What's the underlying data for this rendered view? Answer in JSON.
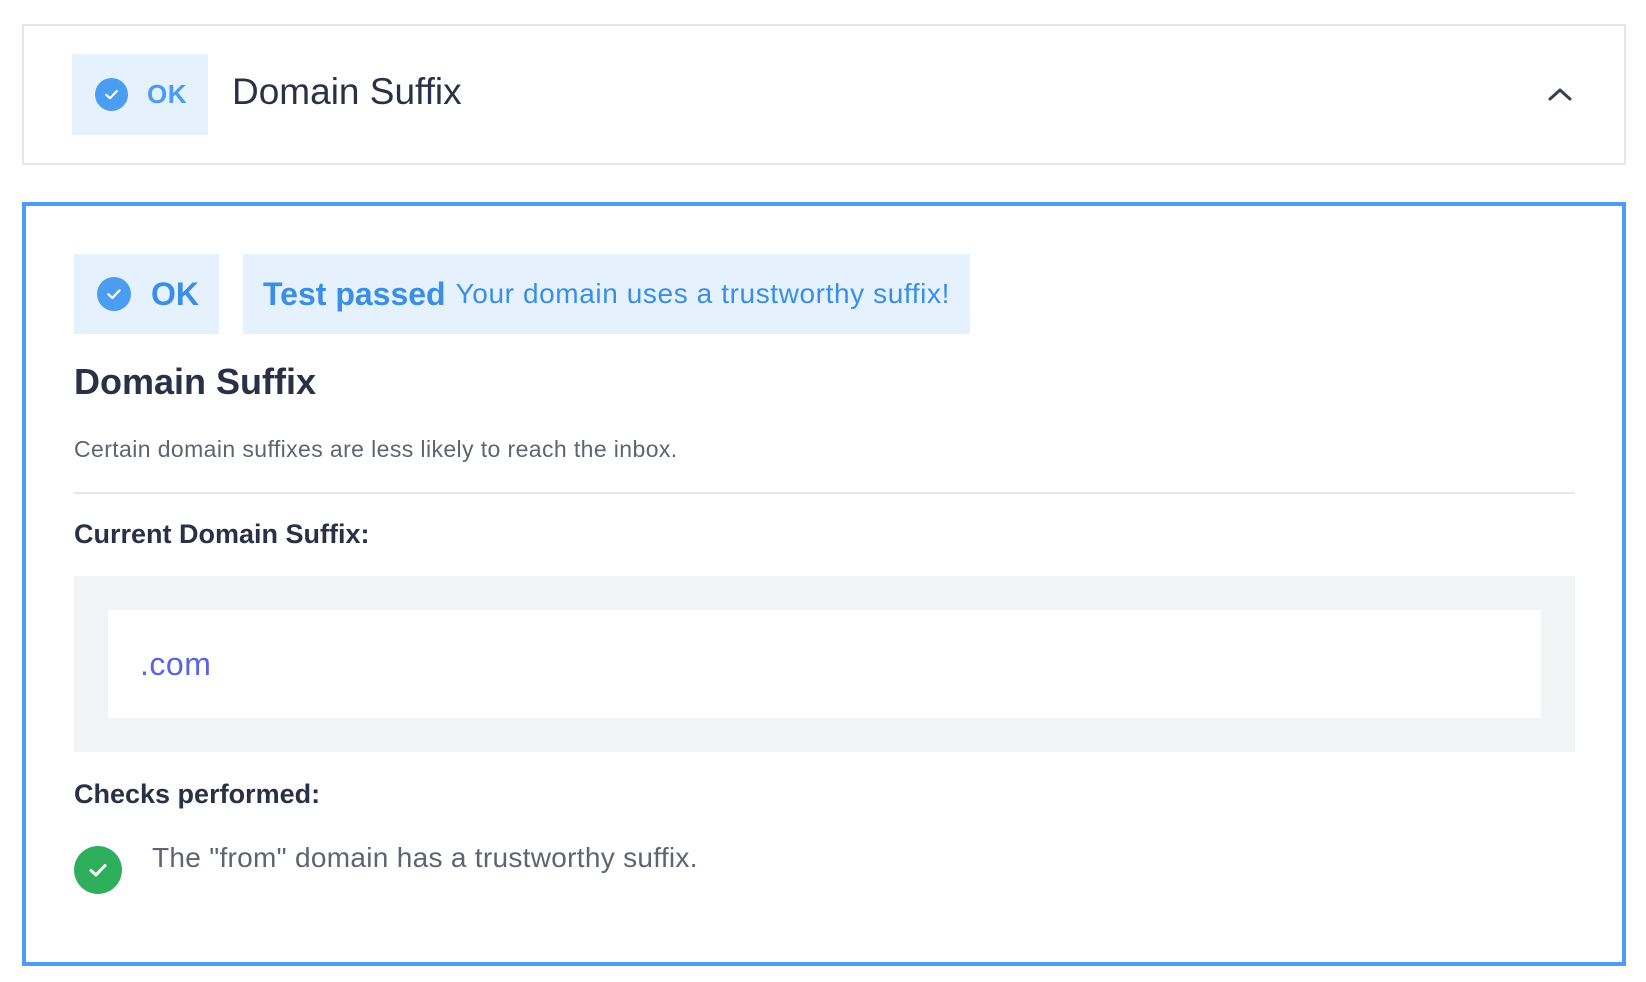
{
  "header": {
    "status_label": "OK",
    "title": "Domain Suffix",
    "toggle_icon": "chevron-up-icon"
  },
  "detail": {
    "status_label": "OK",
    "result_title": "Test passed",
    "result_message": "Your domain uses a trustworthy suffix!",
    "title": "Domain Suffix",
    "description": "Certain domain suffixes are less likely to reach the inbox.",
    "current_suffix_label": "Current Domain Suffix:",
    "current_suffix_value": ".com",
    "checks_label": "Checks performed:",
    "checks": [
      {
        "status": "passed",
        "text": "The \"from\" domain has a trustworthy suffix."
      }
    ]
  },
  "colors": {
    "accent_blue": "#4a9df0",
    "badge_bg": "#e5f1fd",
    "success_green": "#2fae5c",
    "suffix_text": "#5a63e6"
  }
}
